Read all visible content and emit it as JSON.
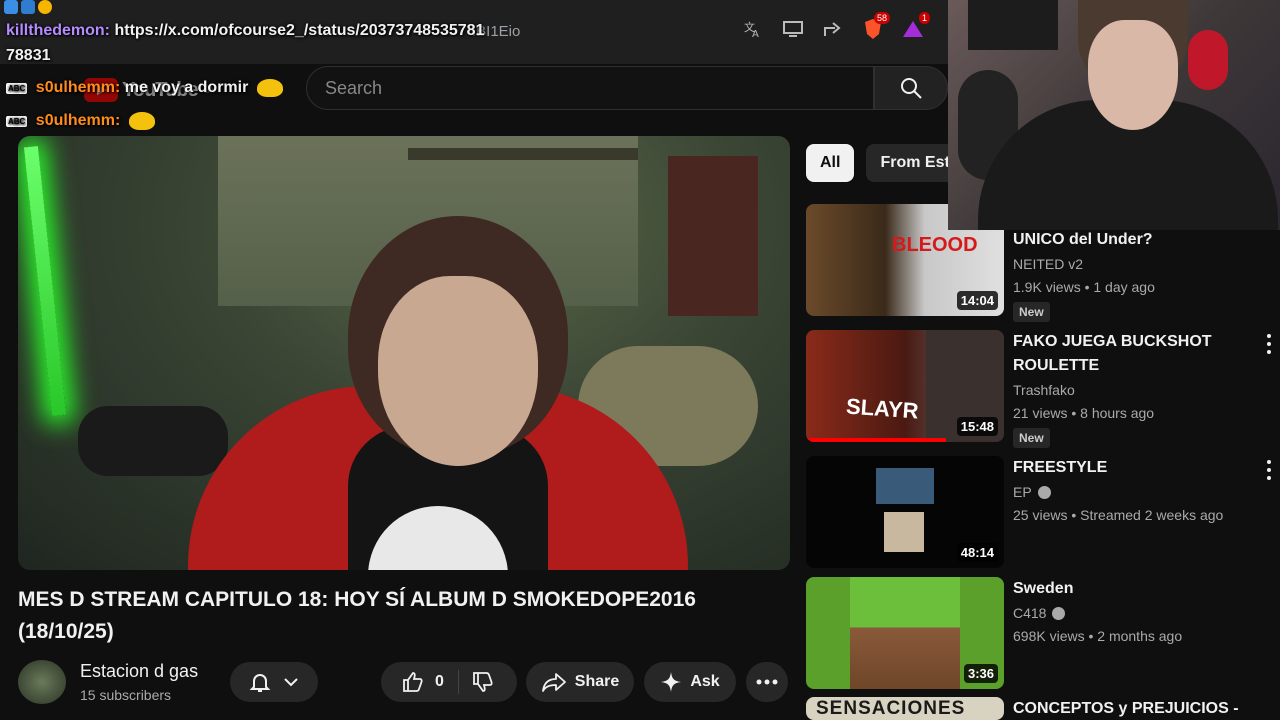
{
  "browser": {
    "url_fragment": "IBI1Eio",
    "shield_badge": "58",
    "notif_badge": "1"
  },
  "header": {
    "logo_text": "YouTube",
    "logo_region": "UY",
    "search_placeholder": "Search"
  },
  "chat": [
    {
      "user": "killthedemon:",
      "message": "https://x.com/ofcourse2_/status/20373748535781",
      "cont": "78831",
      "color": "#b58cff"
    },
    {
      "user": "s0ulhemm:",
      "message": "me voy a dormir",
      "color": "#ff8c1a"
    },
    {
      "user": "s0ulhemm:",
      "message": "",
      "color": "#ff8c1a"
    }
  ],
  "video": {
    "title": "MES D STREAM CAPITULO 18: HOY SÍ ALBUM D SMOKEDOPE2016 (18/10/25)",
    "channel": "Estacion d gas",
    "subscribers": "15 subscribers",
    "likes": "0",
    "share_label": "Share",
    "ask_label": "Ask"
  },
  "chips": [
    "All",
    "From Esta"
  ],
  "recommendations": [
    {
      "title": "UNICO del Under?",
      "channel": "NEITED v2",
      "meta": "1.9K views • 1 day ago",
      "badge": "New",
      "duration": "14:04",
      "verified": false
    },
    {
      "title": "FAKO JUEGA BUCKSHOT ROULETTE",
      "channel": "Trashfako",
      "meta": "21 views • 8 hours ago",
      "badge": "New",
      "duration": "15:48",
      "verified": false,
      "thumb_text": "SLAYR"
    },
    {
      "title": "FREESTYLE",
      "channel": "EP",
      "meta": "25 views • Streamed 2 weeks ago",
      "badge": "",
      "duration": "48:14",
      "verified": true
    },
    {
      "title": "Sweden",
      "channel": "C418",
      "meta": "698K views • 2 months ago",
      "badge": "",
      "duration": "3:36",
      "verified": true
    },
    {
      "title": "CONCEPTOS y PREJUICIOS -",
      "channel": "",
      "meta": "",
      "badge": "",
      "duration": "",
      "verified": false,
      "thumb_text": "SENSACIONES"
    }
  ]
}
